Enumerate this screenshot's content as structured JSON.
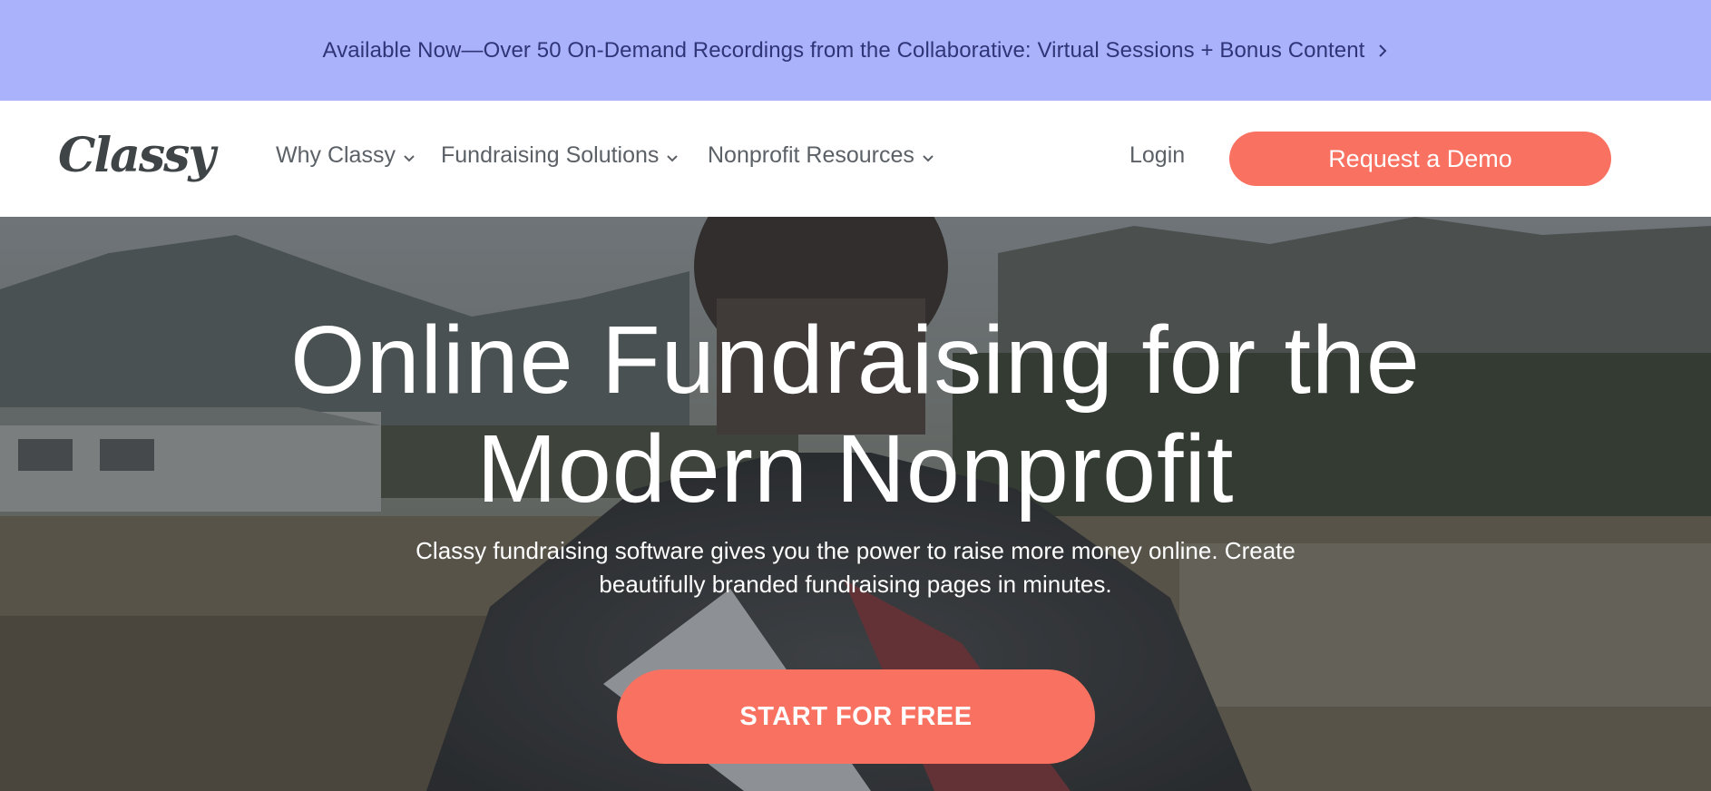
{
  "announcement": {
    "text": "Available Now—Over 50 On-Demand Recordings from the Collaborative: Virtual Sessions + Bonus Content",
    "icon": "chevron-right-icon"
  },
  "header": {
    "logo_text": "Classy",
    "nav": [
      {
        "label": "Why Classy",
        "icon": "chevron-down-icon"
      },
      {
        "label": "Fundraising Solutions",
        "icon": "chevron-down-icon"
      },
      {
        "label": "Nonprofit Resources",
        "icon": "chevron-down-icon"
      }
    ],
    "login_label": "Login",
    "demo_label": "Request a Demo"
  },
  "hero": {
    "title_line1": "Online Fundraising for the",
    "title_line2": "Modern Nonprofit",
    "subtitle": "Classy fundraising software gives you the power to raise more money online. Create beautifully branded fundraising pages in minutes.",
    "cta_label": "START FOR FREE"
  },
  "colors": {
    "banner_bg": "#abb2fc",
    "banner_text": "#2f3576",
    "accent": "#f97161",
    "nav_text": "#5b6166",
    "logo": "#3f4447"
  }
}
